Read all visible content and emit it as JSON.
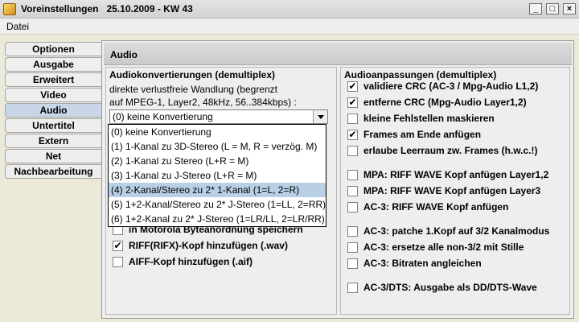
{
  "window": {
    "title": "Voreinstellungen   25.10.2009 - KW 43",
    "minimize": "_",
    "maximize": "□",
    "close": "×"
  },
  "menu": {
    "items": [
      {
        "label": "Datei"
      }
    ]
  },
  "tabs": [
    {
      "label": "Optionen",
      "active": false
    },
    {
      "label": "Ausgabe",
      "active": false
    },
    {
      "label": "Erweitert",
      "active": false
    },
    {
      "label": "Video",
      "active": false
    },
    {
      "label": "Audio",
      "active": true
    },
    {
      "label": "Untertitel",
      "active": false
    },
    {
      "label": "Extern",
      "active": false
    },
    {
      "label": "Net",
      "active": false
    },
    {
      "label": "Nachbearbeitung",
      "active": false
    }
  ],
  "panel": {
    "title": "Audio"
  },
  "left_group": {
    "title": "Audiokonvertierungen (demultiplex)",
    "desc_line1": "direkte verlustfreie Wandlung (begrenzt",
    "desc_line2": "auf MPEG-1, Layer2, 48kHz, 56..384kbps) :",
    "combo_value": "(0) keine Konvertierung",
    "options": [
      "(0) keine Konvertierung",
      "(1) 1-Kanal zu 3D-Stereo (L = M, R = verzög. M)",
      "(2) 1-Kanal zu Stereo (L+R = M)",
      "(3) 1-Kanal zu J-Stereo (L+R = M)",
      "(4) 2-Kanal/Stereo zu 2* 1-Kanal (1=L, 2=R)",
      "(5) 1+2-Kanal/Stereo zu 2* J-Stereo (1=LL, 2=RR)",
      "(6) 1+2-Kanal zu 2* J-Stereo (1=LR/LL, 2=LR/RR)"
    ],
    "selected_index": 4,
    "checkboxes": [
      {
        "label": "in Motorola Byteanordnung speichern",
        "checked": false
      },
      {
        "label": "RIFF(RIFX)-Kopf hinzufügen (.wav)",
        "checked": true
      },
      {
        "label": "AIFF-Kopf hinzufügen (.aif)",
        "checked": false
      }
    ]
  },
  "right_group": {
    "title": "Audioanpassungen (demultiplex)",
    "checkboxes": [
      {
        "label": "validiere CRC (AC-3 / Mpg-Audio L1,2)",
        "checked": true
      },
      {
        "label": "entferne CRC (Mpg-Audio Layer1,2)",
        "checked": true
      },
      {
        "label": "kleine Fehlstellen maskieren",
        "checked": false
      },
      {
        "label": "Frames am Ende anfügen",
        "checked": true
      },
      {
        "label": "erlaube Leerraum zw. Frames (h.w.c.!)",
        "checked": false
      },
      {
        "label": "MPA: RIFF WAVE Kopf anfügen Layer1,2",
        "checked": false
      },
      {
        "label": "MPA: RIFF WAVE Kopf anfügen Layer3",
        "checked": false
      },
      {
        "label": "AC-3: RIFF WAVE Kopf anfügen",
        "checked": false
      },
      {
        "label": "AC-3: patche 1.Kopf auf 3/2 Kanalmodus",
        "checked": false
      },
      {
        "label": "AC-3: ersetze alle non-3/2 mit Stille",
        "checked": false
      },
      {
        "label": "AC-3: Bitraten angleichen",
        "checked": false
      },
      {
        "label": "AC-3/DTS: Ausgabe als DD/DTS-Wave",
        "checked": false
      }
    ]
  }
}
